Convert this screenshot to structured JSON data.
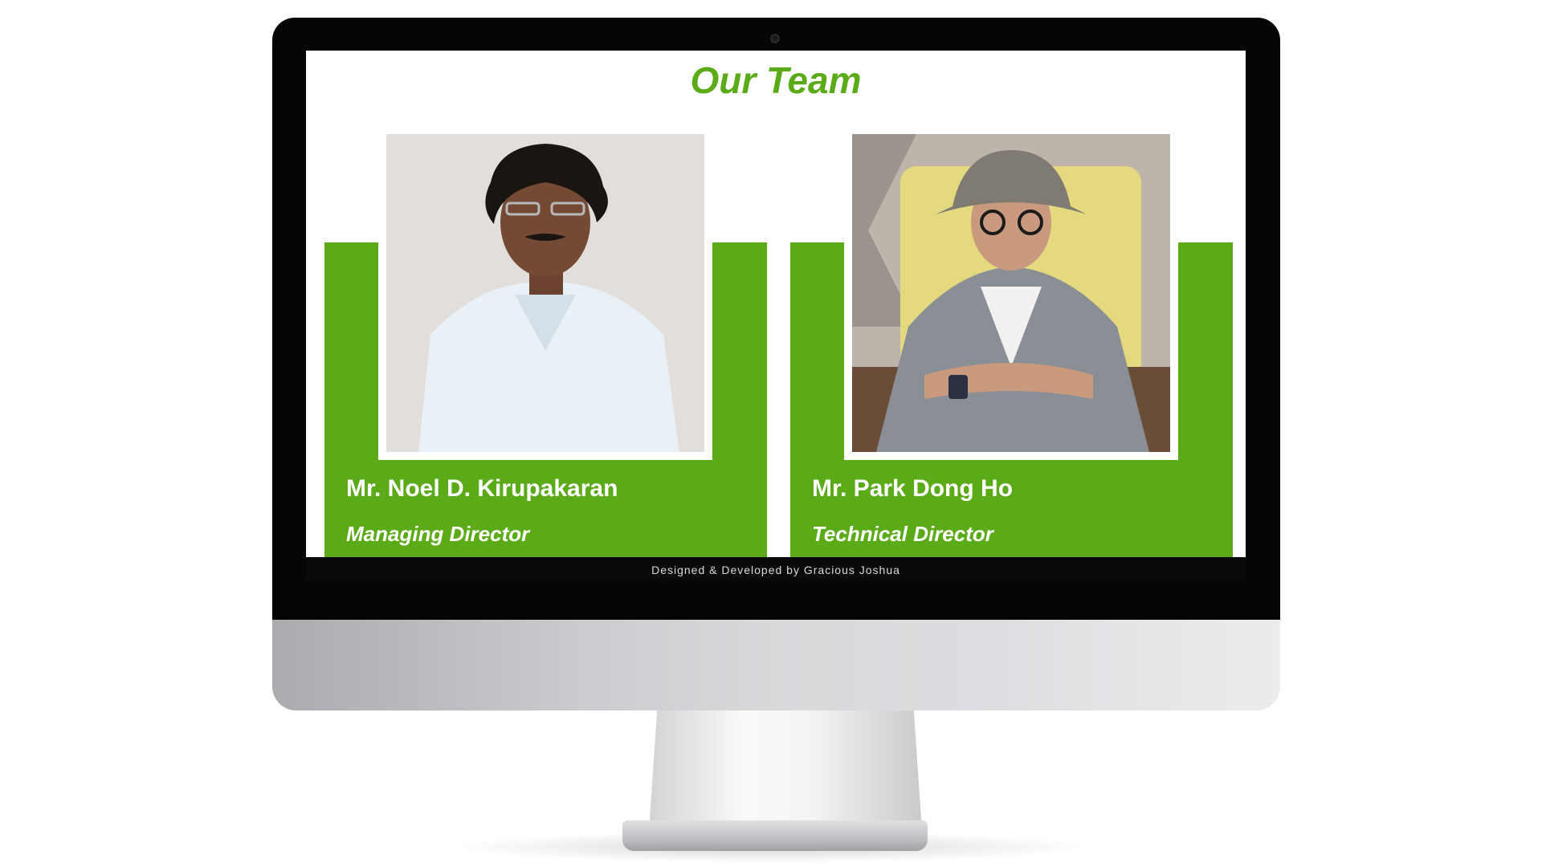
{
  "page": {
    "title": "Our Team"
  },
  "team": {
    "members": [
      {
        "name": "Mr. Noel D. Kirupakaran",
        "role": "Managing Director"
      },
      {
        "name": "Mr. Park Dong Ho",
        "role": "Technical Director"
      }
    ]
  },
  "footer": {
    "credit": "Designed & Developed by Gracious Joshua"
  },
  "colors": {
    "accent": "#5bab19",
    "bezel": "#050505",
    "footer_bg": "#0a0a0a",
    "title": "#5bab19"
  }
}
